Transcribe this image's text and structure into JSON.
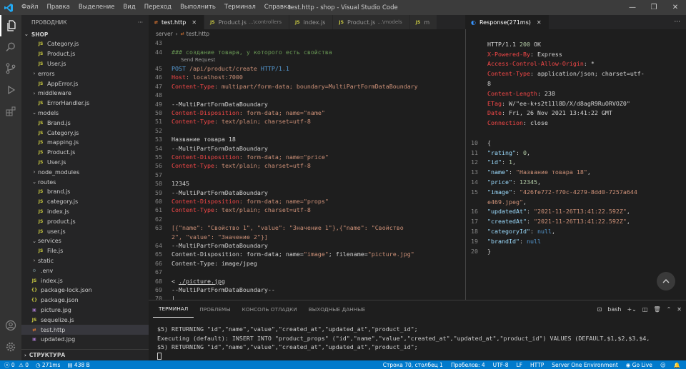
{
  "titlebar": {
    "menu": [
      "Файл",
      "Правка",
      "Выделение",
      "Вид",
      "Переход",
      "Выполнить",
      "Терминал",
      "Справка"
    ],
    "title": "test.http - shop - Visual Studio Code"
  },
  "sidebar": {
    "header": "ПРОВОДНИК",
    "root": "SHOP",
    "structure": "СТРУКТУРА",
    "tree": [
      {
        "label": "Category.js",
        "depth": 2,
        "kind": "js"
      },
      {
        "label": "Product.js",
        "depth": 2,
        "kind": "js"
      },
      {
        "label": "User.js",
        "depth": 2,
        "kind": "js"
      },
      {
        "label": "errors",
        "depth": 1,
        "kind": "folder"
      },
      {
        "label": "AppError.js",
        "depth": 2,
        "kind": "js"
      },
      {
        "label": "middleware",
        "depth": 1,
        "kind": "folder"
      },
      {
        "label": "ErrorHandler.js",
        "depth": 2,
        "kind": "js"
      },
      {
        "label": "models",
        "depth": 1,
        "kind": "folder-open"
      },
      {
        "label": "Brand.js",
        "depth": 2,
        "kind": "js"
      },
      {
        "label": "Category.js",
        "depth": 2,
        "kind": "js"
      },
      {
        "label": "mapping.js",
        "depth": 2,
        "kind": "js"
      },
      {
        "label": "Product.js",
        "depth": 2,
        "kind": "js"
      },
      {
        "label": "User.js",
        "depth": 2,
        "kind": "js"
      },
      {
        "label": "node_modules",
        "depth": 1,
        "kind": "folder"
      },
      {
        "label": "routes",
        "depth": 1,
        "kind": "folder-open"
      },
      {
        "label": "brand.js",
        "depth": 2,
        "kind": "js"
      },
      {
        "label": "category.js",
        "depth": 2,
        "kind": "js"
      },
      {
        "label": "index.js",
        "depth": 2,
        "kind": "js"
      },
      {
        "label": "product.js",
        "depth": 2,
        "kind": "js"
      },
      {
        "label": "user.js",
        "depth": 2,
        "kind": "js"
      },
      {
        "label": "services",
        "depth": 1,
        "kind": "folder-open"
      },
      {
        "label": "File.js",
        "depth": 2,
        "kind": "js"
      },
      {
        "label": "static",
        "depth": 1,
        "kind": "folder"
      },
      {
        "label": ".env",
        "depth": 1,
        "kind": "env"
      },
      {
        "label": "index.js",
        "depth": 1,
        "kind": "js"
      },
      {
        "label": "package-lock.json",
        "depth": 1,
        "kind": "json"
      },
      {
        "label": "package.json",
        "depth": 1,
        "kind": "json"
      },
      {
        "label": "picture.jpg",
        "depth": 1,
        "kind": "img"
      },
      {
        "label": "sequelize.js",
        "depth": 1,
        "kind": "js"
      },
      {
        "label": "test.http",
        "depth": 1,
        "kind": "http",
        "selected": true
      },
      {
        "label": "updated.jpg",
        "depth": 1,
        "kind": "img"
      }
    ]
  },
  "tabs": [
    {
      "label": "test.http",
      "desc": "",
      "kind": "http",
      "active": true
    },
    {
      "label": "Product.js",
      "desc": "...\\controllers",
      "kind": "js"
    },
    {
      "label": "index.js",
      "desc": "",
      "kind": "js"
    },
    {
      "label": "Product.js",
      "desc": "...\\models",
      "kind": "js"
    },
    {
      "label": "m",
      "desc": "",
      "kind": "js"
    }
  ],
  "breadcrumb": [
    "server",
    "test.http"
  ],
  "editor": {
    "codelens": "Send Request",
    "lines": [
      {
        "n": "43",
        "parts": []
      },
      {
        "n": "44",
        "parts": [
          {
            "t": "### создание товара, у которого есть свойства",
            "c": "#6a9955"
          }
        ]
      },
      {
        "n": "45",
        "parts": [
          {
            "t": "POST",
            "c": "#569cd6"
          },
          {
            "t": " /api/product/create ",
            "c": "#ce9178"
          },
          {
            "t": "HTTP/1.1",
            "c": "#569cd6"
          }
        ]
      },
      {
        "n": "46",
        "parts": [
          {
            "t": "Host",
            "c": "#f44747"
          },
          {
            "t": ": localhost:7000",
            "c": "#ce9178"
          }
        ]
      },
      {
        "n": "47",
        "parts": [
          {
            "t": "Content-Type",
            "c": "#f44747"
          },
          {
            "t": ": multipart/form-data; boundary=MultiPartFormDataBoundary",
            "c": "#ce9178"
          }
        ]
      },
      {
        "n": "48",
        "parts": []
      },
      {
        "n": "49",
        "parts": [
          {
            "t": "--MultiPartFormDataBoundary",
            "c": "#d4d4d4"
          }
        ]
      },
      {
        "n": "50",
        "parts": [
          {
            "t": "Content-Disposition",
            "c": "#f44747"
          },
          {
            "t": ": form-data; name=",
            "c": "#ce9178"
          },
          {
            "t": "\"name\"",
            "c": "#ce9178"
          }
        ]
      },
      {
        "n": "51",
        "parts": [
          {
            "t": "Content-Type",
            "c": "#f44747"
          },
          {
            "t": ": text/plain; charset=utf-8",
            "c": "#ce9178"
          }
        ]
      },
      {
        "n": "52",
        "parts": []
      },
      {
        "n": "53",
        "parts": [
          {
            "t": "Название товара 18",
            "c": "#d4d4d4"
          }
        ]
      },
      {
        "n": "54",
        "parts": [
          {
            "t": "--MultiPartFormDataBoundary",
            "c": "#d4d4d4"
          }
        ]
      },
      {
        "n": "55",
        "parts": [
          {
            "t": "Content-Disposition",
            "c": "#f44747"
          },
          {
            "t": ": form-data; name=",
            "c": "#ce9178"
          },
          {
            "t": "\"price\"",
            "c": "#ce9178"
          }
        ]
      },
      {
        "n": "56",
        "parts": [
          {
            "t": "Content-Type",
            "c": "#f44747"
          },
          {
            "t": ": text/plain; charset=utf-8",
            "c": "#ce9178"
          }
        ]
      },
      {
        "n": "57",
        "parts": []
      },
      {
        "n": "58",
        "parts": [
          {
            "t": "12345",
            "c": "#d4d4d4"
          }
        ]
      },
      {
        "n": "59",
        "parts": [
          {
            "t": "--MultiPartFormDataBoundary",
            "c": "#d4d4d4"
          }
        ]
      },
      {
        "n": "60",
        "parts": [
          {
            "t": "Content-Disposition",
            "c": "#f44747"
          },
          {
            "t": ": form-data; name=",
            "c": "#ce9178"
          },
          {
            "t": "\"props\"",
            "c": "#ce9178"
          }
        ]
      },
      {
        "n": "61",
        "parts": [
          {
            "t": "Content-Type",
            "c": "#f44747"
          },
          {
            "t": ": text/plain; charset=utf-8",
            "c": "#ce9178"
          }
        ]
      },
      {
        "n": "62",
        "parts": []
      },
      {
        "n": "63",
        "parts": [
          {
            "t": "[{\"name\": ",
            "c": "#ce9178"
          },
          {
            "t": "\"Свойство 1\"",
            "c": "#ce9178"
          },
          {
            "t": ", \"value\": ",
            "c": "#ce9178"
          },
          {
            "t": "\"Значение 1\"",
            "c": "#ce9178"
          },
          {
            "t": "},{\"name\": ",
            "c": "#ce9178"
          },
          {
            "t": "\"Свойство",
            "c": "#ce9178"
          }
        ]
      },
      {
        "n": "",
        "parts": [
          {
            "t": "2\", \"value\": \"Значение 2\"}]",
            "c": "#ce9178"
          }
        ]
      },
      {
        "n": "64",
        "parts": [
          {
            "t": "--MultiPartFormDataBoundary",
            "c": "#d4d4d4"
          }
        ]
      },
      {
        "n": "65",
        "parts": [
          {
            "t": "Content-Disposition: form-data; name=",
            "c": "#d4d4d4"
          },
          {
            "t": "\"image\"",
            "c": "#ce9178"
          },
          {
            "t": "; filename=",
            "c": "#d4d4d4"
          },
          {
            "t": "\"picture.jpg\"",
            "c": "#ce9178"
          }
        ]
      },
      {
        "n": "66",
        "parts": [
          {
            "t": "Content-Type: image/jpeg",
            "c": "#d4d4d4"
          }
        ]
      },
      {
        "n": "67",
        "parts": []
      },
      {
        "n": "68",
        "parts": [
          {
            "t": "< ",
            "c": "#d4d4d4"
          },
          {
            "t": "./picture.jpg",
            "c": "#d4d4d4",
            "u": true
          }
        ]
      },
      {
        "n": "69",
        "parts": [
          {
            "t": "--MultiPartFormDataBoundary--",
            "c": "#d4d4d4"
          }
        ]
      },
      {
        "n": "70",
        "parts": [
          {
            "t": "|",
            "c": "#d4d4d4"
          }
        ]
      }
    ]
  },
  "response": {
    "tab_label": "Response(271ms)",
    "lines": [
      {
        "n": "",
        "parts": [
          {
            "t": "HTTP/1.1 ",
            "c": "#d4d4d4"
          },
          {
            "t": "200",
            "c": "#b5cea8"
          },
          {
            "t": " OK",
            "c": "#d4d4d4"
          }
        ]
      },
      {
        "n": "",
        "parts": [
          {
            "t": "X-Powered-By",
            "c": "#f44747"
          },
          {
            "t": ": Express",
            "c": "#d4d4d4"
          }
        ]
      },
      {
        "n": "",
        "parts": [
          {
            "t": "Access-Control-Allow-Origin",
            "c": "#f44747"
          },
          {
            "t": ": *",
            "c": "#d4d4d4"
          }
        ]
      },
      {
        "n": "",
        "parts": [
          {
            "t": "Content-Type",
            "c": "#f44747"
          },
          {
            "t": ": application/json; charset=utf-",
            "c": "#d4d4d4"
          }
        ]
      },
      {
        "n": "",
        "parts": [
          {
            "t": "8",
            "c": "#d4d4d4"
          }
        ]
      },
      {
        "n": "",
        "parts": [
          {
            "t": "Content-Length",
            "c": "#f44747"
          },
          {
            "t": ": 238",
            "c": "#d4d4d4"
          }
        ]
      },
      {
        "n": "",
        "parts": [
          {
            "t": "ETag",
            "c": "#f44747"
          },
          {
            "t": ": W/\"ee-k+s2t11l8D/X/d8agR9RuORVOZ0\"",
            "c": "#d4d4d4"
          }
        ]
      },
      {
        "n": "",
        "parts": [
          {
            "t": "Date",
            "c": "#f44747"
          },
          {
            "t": ": Fri, 26 Nov 2021 13:41:22 GMT",
            "c": "#d4d4d4"
          }
        ]
      },
      {
        "n": "",
        "parts": [
          {
            "t": "Connection",
            "c": "#f44747"
          },
          {
            "t": ": close",
            "c": "#d4d4d4"
          }
        ]
      },
      {
        "n": "",
        "parts": []
      },
      {
        "n": "10",
        "parts": [
          {
            "t": "{",
            "c": "#d4d4d4"
          }
        ]
      },
      {
        "n": "11",
        "parts": [
          {
            "t": "  \"rating\"",
            "c": "#9cdcfe"
          },
          {
            "t": ": ",
            "c": "#d4d4d4"
          },
          {
            "t": "0",
            "c": "#b5cea8"
          },
          {
            "t": ",",
            "c": "#d4d4d4"
          }
        ]
      },
      {
        "n": "12",
        "parts": [
          {
            "t": "  \"id\"",
            "c": "#9cdcfe"
          },
          {
            "t": ": ",
            "c": "#d4d4d4"
          },
          {
            "t": "1",
            "c": "#b5cea8"
          },
          {
            "t": ",",
            "c": "#d4d4d4"
          }
        ]
      },
      {
        "n": "13",
        "parts": [
          {
            "t": "  \"name\"",
            "c": "#9cdcfe"
          },
          {
            "t": ": ",
            "c": "#d4d4d4"
          },
          {
            "t": "\"Название товара 18\"",
            "c": "#ce9178"
          },
          {
            "t": ",",
            "c": "#d4d4d4"
          }
        ]
      },
      {
        "n": "14",
        "parts": [
          {
            "t": "  \"price\"",
            "c": "#9cdcfe"
          },
          {
            "t": ": ",
            "c": "#d4d4d4"
          },
          {
            "t": "12345",
            "c": "#b5cea8"
          },
          {
            "t": ",",
            "c": "#d4d4d4"
          }
        ]
      },
      {
        "n": "15",
        "parts": [
          {
            "t": "  \"image\"",
            "c": "#9cdcfe"
          },
          {
            "t": ": ",
            "c": "#d4d4d4"
          },
          {
            "t": "\"426fe772-f70c-4279-8dd0-7257a644",
            "c": "#ce9178"
          }
        ]
      },
      {
        "n": "",
        "parts": [
          {
            "t": "  e469.jpeg\"",
            "c": "#ce9178"
          },
          {
            "t": ",",
            "c": "#d4d4d4"
          }
        ]
      },
      {
        "n": "16",
        "parts": [
          {
            "t": "  \"updatedAt\"",
            "c": "#9cdcfe"
          },
          {
            "t": ": ",
            "c": "#d4d4d4"
          },
          {
            "t": "\"2021-11-26T13:41:22.592Z\"",
            "c": "#ce9178"
          },
          {
            "t": ",",
            "c": "#d4d4d4"
          }
        ]
      },
      {
        "n": "17",
        "parts": [
          {
            "t": "  \"createdAt\"",
            "c": "#9cdcfe"
          },
          {
            "t": ": ",
            "c": "#d4d4d4"
          },
          {
            "t": "\"2021-11-26T13:41:22.592Z\"",
            "c": "#ce9178"
          },
          {
            "t": ",",
            "c": "#d4d4d4"
          }
        ]
      },
      {
        "n": "18",
        "parts": [
          {
            "t": "  \"categoryId\"",
            "c": "#9cdcfe"
          },
          {
            "t": ": ",
            "c": "#d4d4d4"
          },
          {
            "t": "null",
            "c": "#569cd6"
          },
          {
            "t": ",",
            "c": "#d4d4d4"
          }
        ]
      },
      {
        "n": "19",
        "parts": [
          {
            "t": "  \"brandId\"",
            "c": "#9cdcfe"
          },
          {
            "t": ": ",
            "c": "#d4d4d4"
          },
          {
            "t": "null",
            "c": "#569cd6"
          }
        ]
      },
      {
        "n": "20",
        "parts": [
          {
            "t": "}",
            "c": "#d4d4d4"
          }
        ]
      }
    ]
  },
  "panel": {
    "tabs": [
      "ТЕРМИНАЛ",
      "ПРОБЛЕМЫ",
      "КОНСОЛЬ ОТЛАДКИ",
      "ВЫХОДНЫЕ ДАННЫЕ"
    ],
    "shell": "1: bash",
    "shell_label": "bash",
    "lines": [
      "$5) RETURNING \"id\",\"name\",\"value\",\"created_at\",\"updated_at\",\"product_id\";",
      "Executing (default): INSERT INTO \"product_props\" (\"id\",\"name\",\"value\",\"created_at\",\"updated_at\",\"product_id\") VALUES (DEFAULT,$1,$2,$3,$4,",
      "$5) RETURNING \"id\",\"name\",\"value\",\"created_at\",\"updated_at\",\"product_id\";"
    ]
  },
  "status": {
    "errors": "0",
    "warnings": "0",
    "timing": "271ms",
    "size": "438 B",
    "position": "Строка 70, столбец 1",
    "spaces": "Пробелов: 4",
    "encoding": "UTF-8",
    "eol": "LF",
    "language": "HTTP",
    "env": "Server One Environment",
    "golive": "Go Live"
  },
  "colors": {
    "accent": "#007acc",
    "background": "#1e1e1e",
    "sidebar": "#252526"
  }
}
